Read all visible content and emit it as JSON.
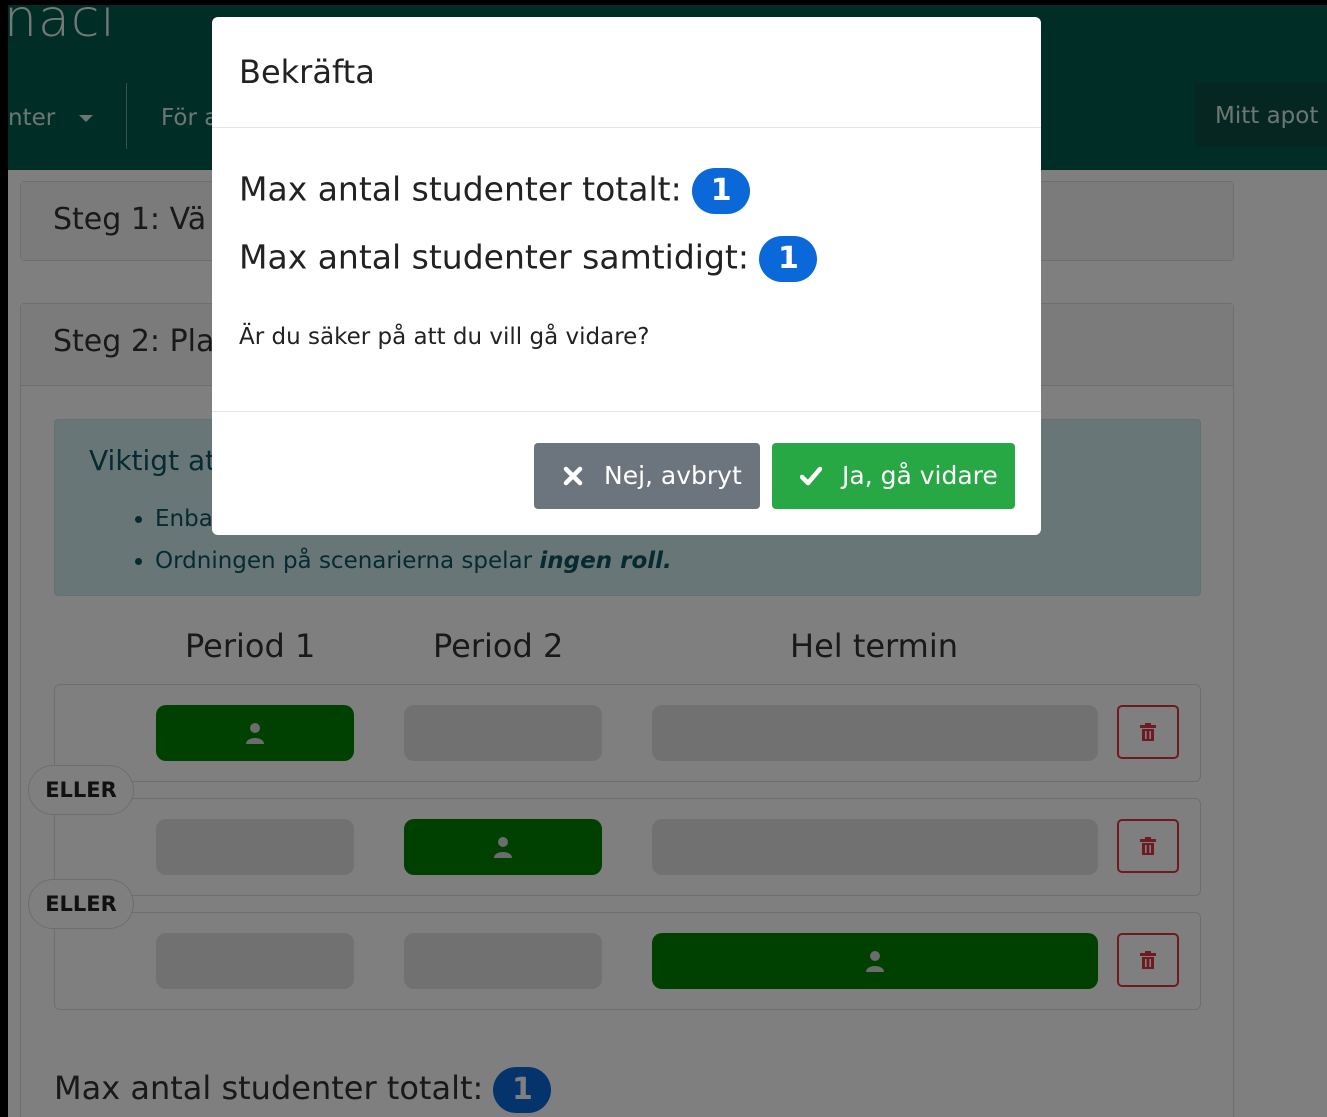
{
  "app": {
    "brand": "naci"
  },
  "nav": {
    "items": [
      {
        "label": "nter",
        "has_caret": true
      },
      {
        "label": "För a"
      }
    ],
    "right_label": "Mitt apot"
  },
  "steps": {
    "step1_title": "Steg 1: Vä",
    "step2_title": "Steg 2: Pla"
  },
  "info": {
    "heading": "Viktigt at",
    "bullets": [
      {
        "text": "Enba"
      },
      {
        "text": "Ordningen på scenarierna spelar ",
        "emph": "ingen roll."
      }
    ]
  },
  "periods": [
    "Period 1",
    "Period 2",
    "Hel termin"
  ],
  "scenarios": [
    {
      "active": "period1"
    },
    {
      "active": "period2"
    },
    {
      "active": "full"
    }
  ],
  "separator_label": "ELLER",
  "summary": {
    "label": "Max antal studenter totalt:",
    "value": "1"
  },
  "modal": {
    "title": "Bekräfta",
    "lines": [
      {
        "label": "Max antal studenter totalt:",
        "value": "1"
      },
      {
        "label": "Max antal studenter samtidigt:",
        "value": "1"
      }
    ],
    "question": "Är du säker på att du vill gå vidare?",
    "cancel_label": "Nej, avbryt",
    "confirm_label": "Ja, gå vidare"
  },
  "colors": {
    "topbar": "#005c4e",
    "slot_active": "#008000",
    "badge": "#0a68d8",
    "cancel": "#6c757d",
    "confirm": "#28a745",
    "delete": "#dc3545"
  },
  "icons": {
    "slot": "user-icon",
    "delete": "trash-icon",
    "cancel": "close-icon",
    "confirm": "check-icon"
  }
}
